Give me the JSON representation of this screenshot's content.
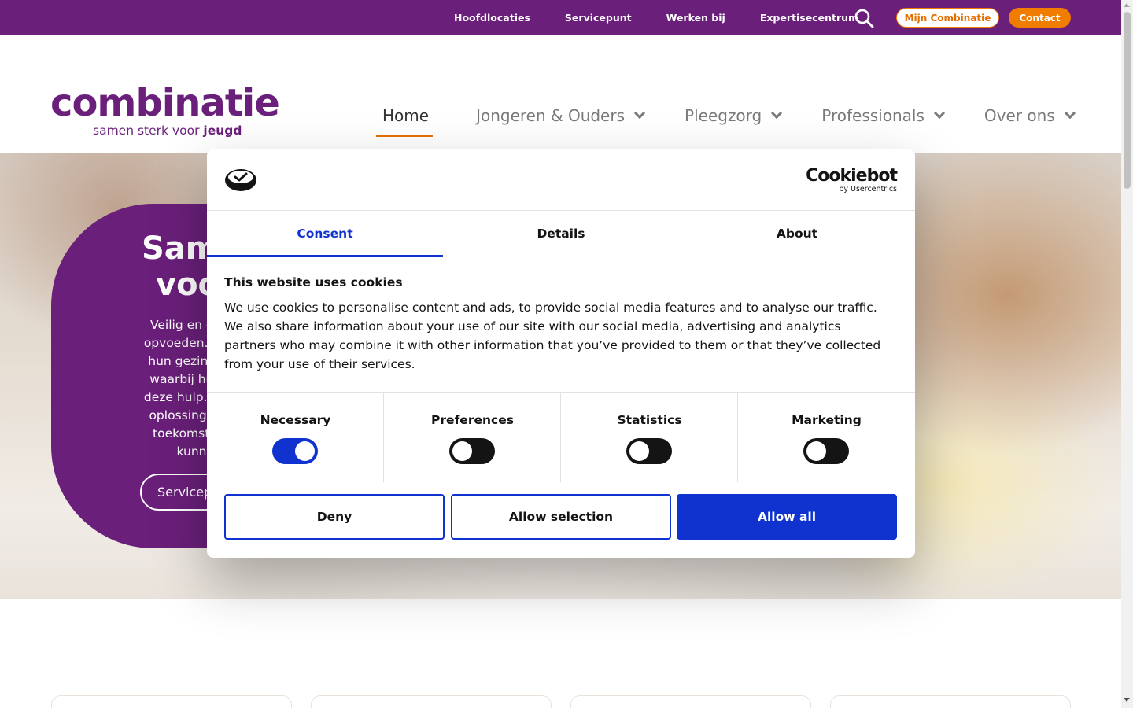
{
  "topbar": {
    "links": [
      "Hoofdlocaties",
      "Servicepunt",
      "Werken bij",
      "Expertisecentrum"
    ],
    "search_icon": "search-icon",
    "mijn_label": "Mijn Combinatie",
    "contact_label": "Contact",
    "color": "#6a1f7a",
    "accent": "#f07d00"
  },
  "header": {
    "logo_word": "combinatie",
    "logo_tagline_pre": "samen sterk voor ",
    "logo_tagline_bold": "jeugd",
    "nav": [
      {
        "label": "Home",
        "has_dropdown": false,
        "active": true
      },
      {
        "label": "Jongeren & Ouders",
        "has_dropdown": true,
        "active": false
      },
      {
        "label": "Pleegzorg",
        "has_dropdown": true,
        "active": false
      },
      {
        "label": "Professionals",
        "has_dropdown": true,
        "active": false
      },
      {
        "label": "Over ons",
        "has_dropdown": true,
        "active": false
      }
    ]
  },
  "hero": {
    "title_line1": "Sam",
    "title_line2": "voo",
    "text_lines": [
      "Veilig en gezond o",
      "opvoeden. Dat gunn",
      "hun gezinnen. Maa",
      "waarbij hulp nodig",
      "deze hulp. Voor kind",
      "oplossingen waarn",
      "toekomst. Samen",
      "kunnen w"
    ],
    "button_label": "Servicep"
  },
  "cookie_dialog": {
    "brand_name": "Cookiebot",
    "brand_by": "by Usercentrics",
    "tabs": [
      "Consent",
      "Details",
      "About"
    ],
    "active_tab": "Consent",
    "title": "This website uses cookies",
    "text": "We use cookies to personalise content and ads, to provide social media features and to analyse our traffic. We also share information about your use of our site with our social media, advertising and analytics partners who may combine it with other information that you’ve provided to them or that they’ve collected from your use of their services.",
    "categories": [
      {
        "label": "Necessary",
        "enabled": true
      },
      {
        "label": "Preferences",
        "enabled": false
      },
      {
        "label": "Statistics",
        "enabled": false
      },
      {
        "label": "Marketing",
        "enabled": false
      }
    ],
    "buttons": {
      "deny": "Deny",
      "allow_selection": "Allow selection",
      "allow_all": "Allow all"
    },
    "accent": "#1032cf"
  }
}
